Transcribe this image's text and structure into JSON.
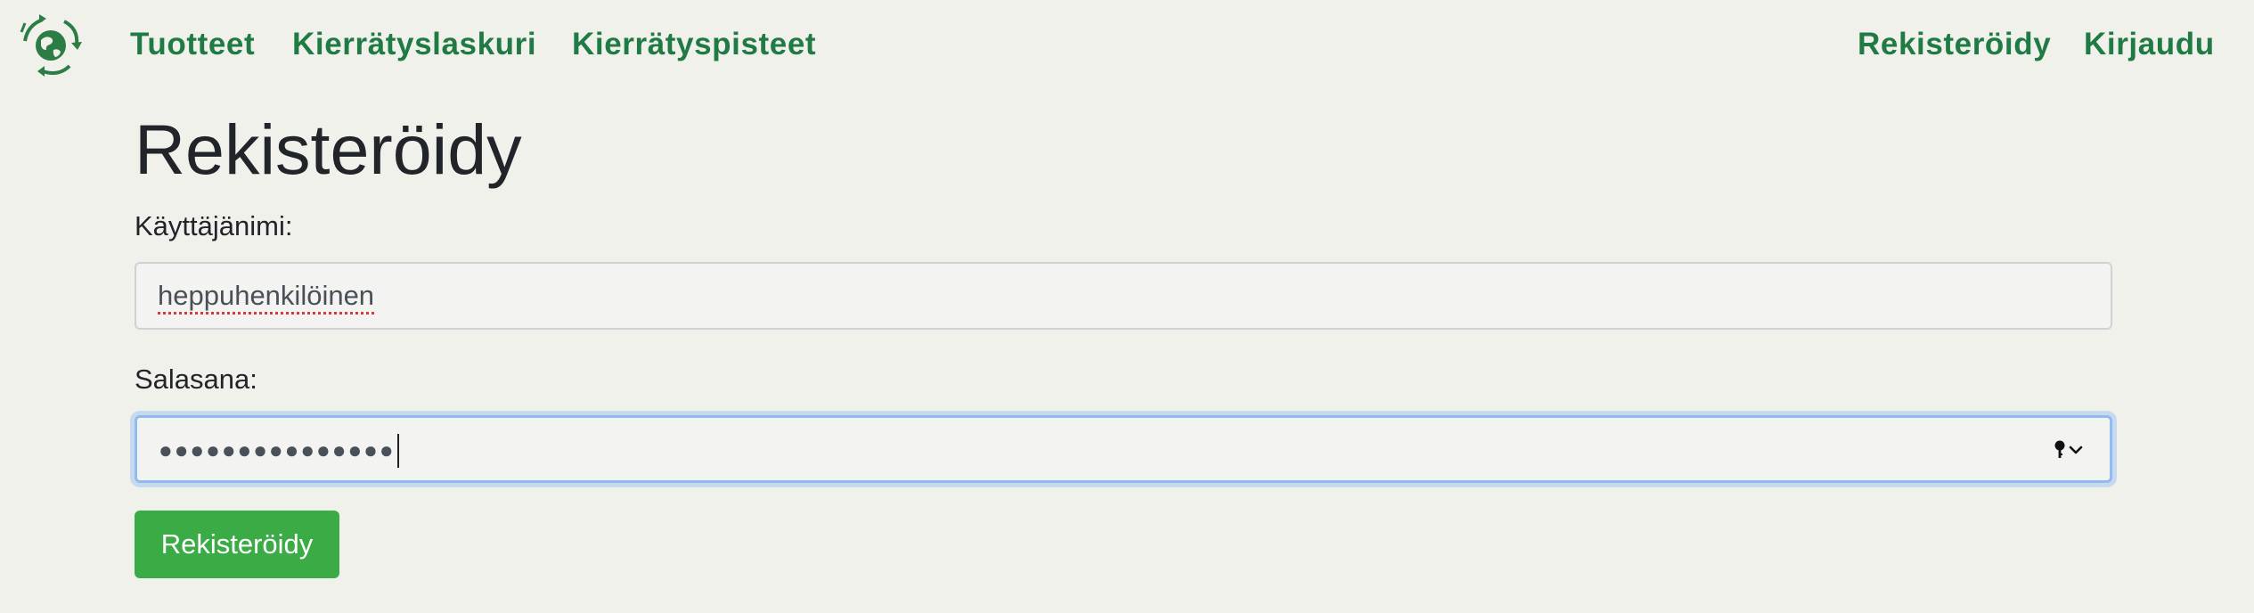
{
  "nav": {
    "logo_icon": "recycling-globe-icon",
    "links": [
      {
        "label": "Tuotteet"
      },
      {
        "label": "Kierrätyslaskuri"
      },
      {
        "label": "Kierrätyspisteet"
      }
    ],
    "right_links": [
      {
        "label": "Rekisteröidy"
      },
      {
        "label": "Kirjaudu"
      }
    ]
  },
  "form": {
    "title": "Rekisteröidy",
    "username_label": "Käyttäjänimi:",
    "username_value": "heppuhenkilöinen",
    "password_label": "Salasana:",
    "password_masked": "●●●●●●●●●●●●●●●",
    "password_icon": "key-dropdown-icon",
    "submit_label": "Rekisteröidy"
  },
  "colors": {
    "background": "#f1f1ec",
    "nav_link": "#1f7a44",
    "submit_button": "#3aab45",
    "focus_border": "#8fbbef"
  }
}
